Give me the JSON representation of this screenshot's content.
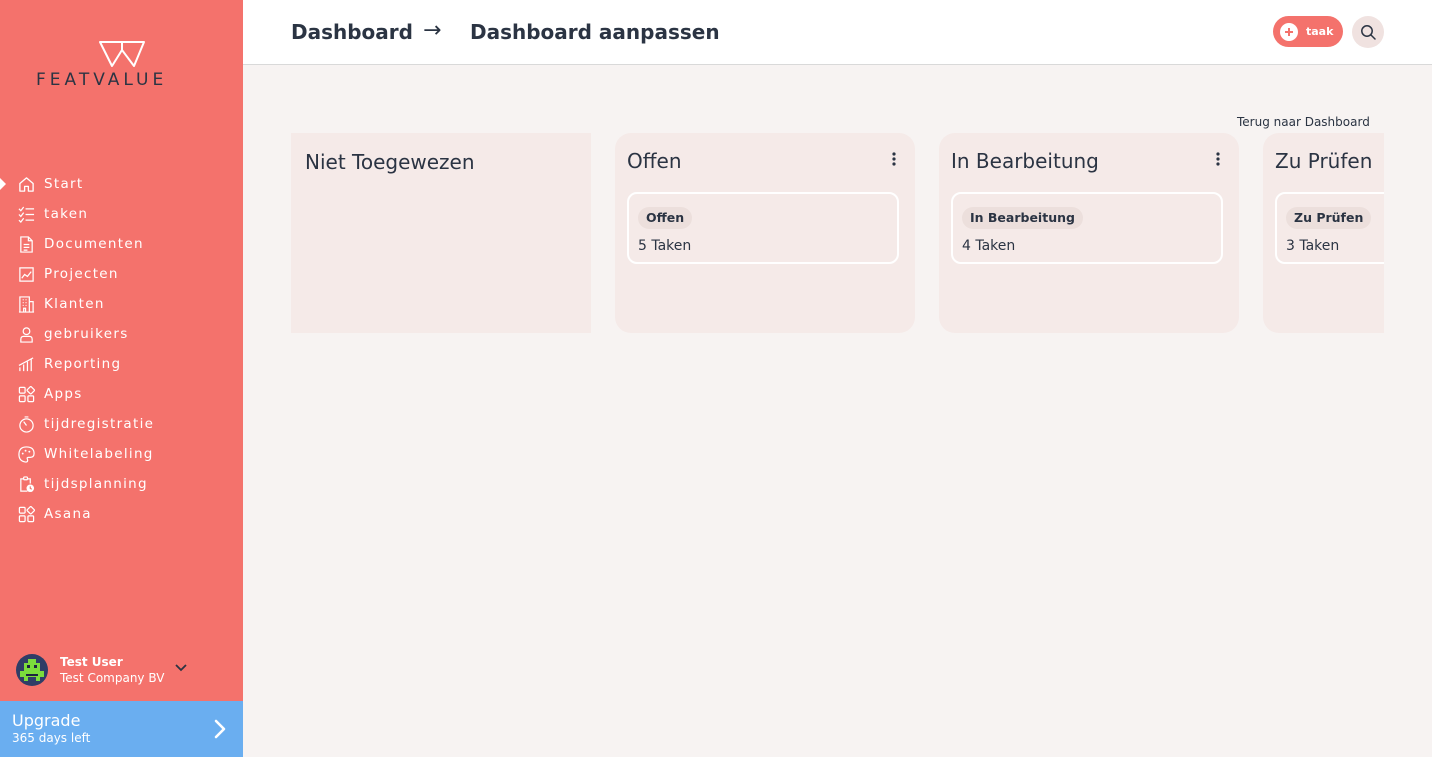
{
  "brand": {
    "name": "FEATVALUE"
  },
  "sidebar": {
    "items": [
      {
        "label": "Start",
        "icon": "home-icon",
        "active": true
      },
      {
        "label": "taken",
        "icon": "checklist-icon"
      },
      {
        "label": "Documenten",
        "icon": "document-icon"
      },
      {
        "label": "Projecten",
        "icon": "chart-icon"
      },
      {
        "label": "Klanten",
        "icon": "building-icon"
      },
      {
        "label": "gebruikers",
        "icon": "user-icon"
      },
      {
        "label": "Reporting",
        "icon": "bar-chart-icon"
      },
      {
        "label": "Apps",
        "icon": "apps-icon"
      },
      {
        "label": "tijdregistratie",
        "icon": "timer-icon"
      },
      {
        "label": "Whitelabeling",
        "icon": "palette-icon"
      },
      {
        "label": "tijdsplanning",
        "icon": "clipboard-clock-icon"
      },
      {
        "label": "Asana",
        "icon": "apps-icon"
      }
    ]
  },
  "user": {
    "name": "Test User",
    "company": "Test Company BV"
  },
  "upgrade": {
    "title": "Upgrade",
    "subtitle": "365 days left"
  },
  "header": {
    "breadcrumb": [
      "Dashboard",
      "Dashboard aanpassen"
    ],
    "arrow": "→",
    "task_button": "taak"
  },
  "main": {
    "back_link": "Terug naar Dashboard",
    "columns": [
      {
        "title": "Niet Toegewezen"
      },
      {
        "title": "Offen",
        "status": "Offen",
        "count": "5 Taken"
      },
      {
        "title": "In Bearbeitung",
        "status": "In Bearbeitung",
        "count": "4 Taken"
      },
      {
        "title": "Zu Prüfen",
        "status": "Zu Prüfen",
        "count": "3 Taken"
      }
    ]
  },
  "colors": {
    "sidebar": "#f4726c",
    "upgrade": "#6aaef0",
    "text": "#2b3443",
    "column": "#f5eae8"
  }
}
